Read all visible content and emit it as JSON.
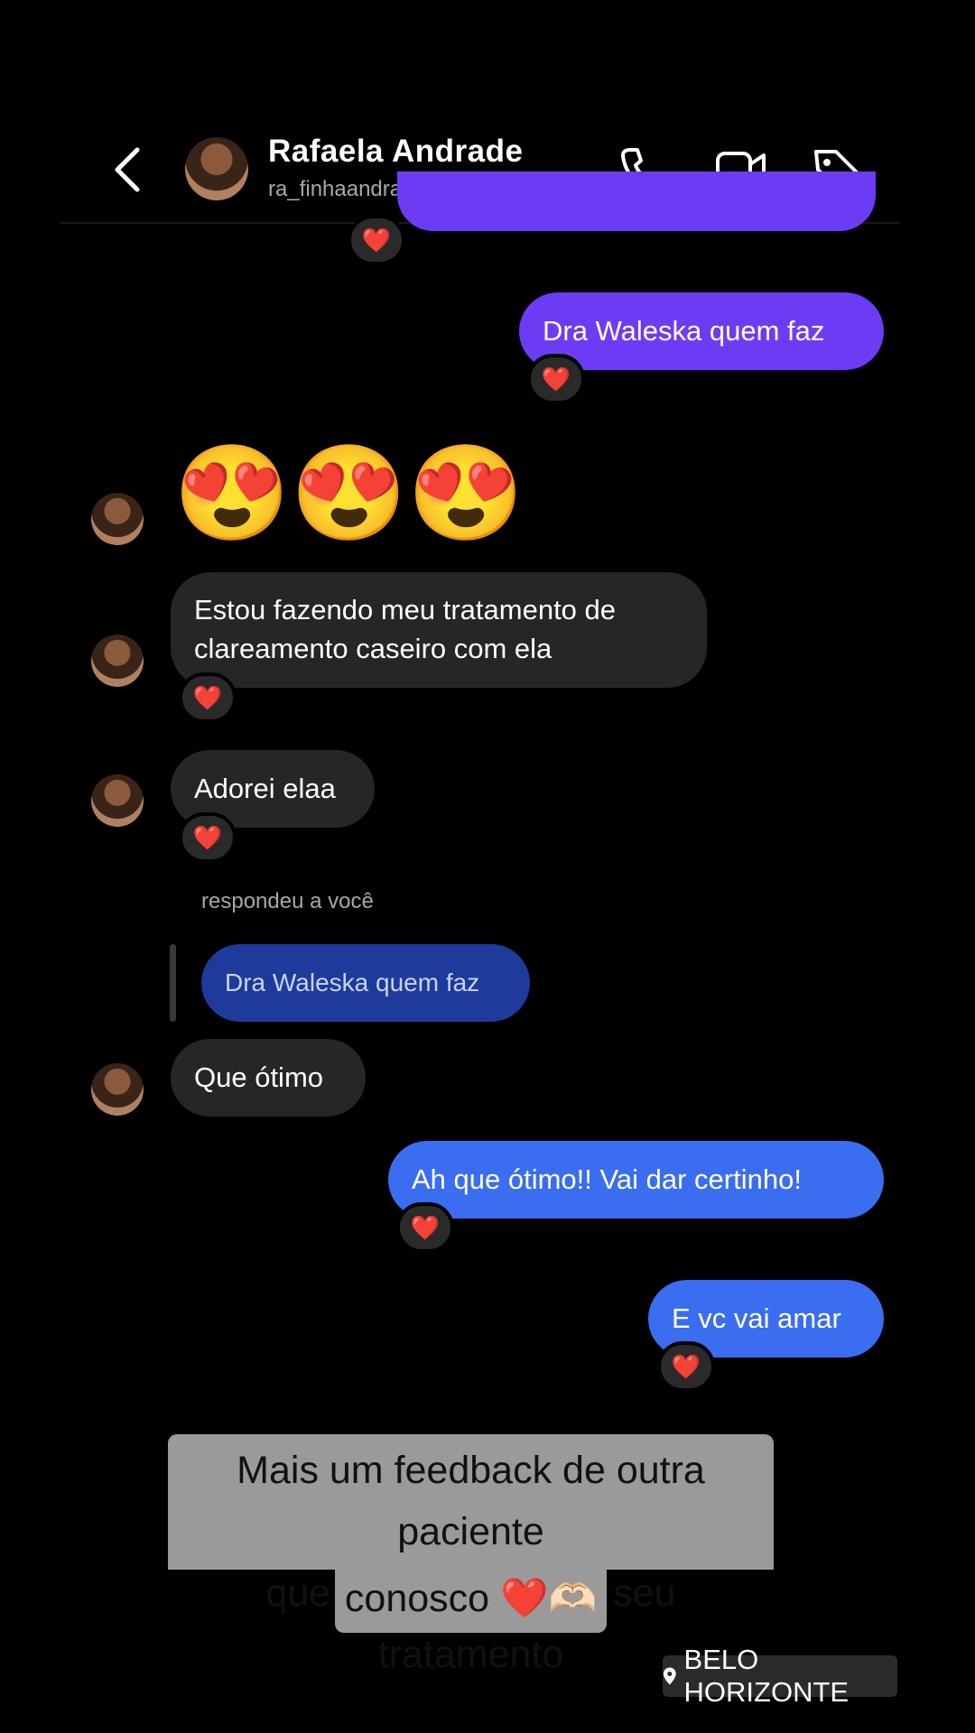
{
  "header": {
    "contact_name": "Rafaela  Andrade",
    "contact_handle": "ra_finhaandrade",
    "icons": [
      "chevron-left-icon",
      "phone-icon",
      "video-icon",
      "tag-icon"
    ]
  },
  "messages": [
    {
      "side": "out",
      "text": "Dra Waleska quem faz",
      "reaction": "❤️"
    },
    {
      "side": "in",
      "text": "😍😍😍"
    },
    {
      "side": "in",
      "text_line1": "Estou fazendo meu tratamento de",
      "text_line2": "clareamento caseiro com ela",
      "reaction": "❤️"
    },
    {
      "side": "in",
      "text": "Adorei elaa",
      "reaction": "❤️"
    },
    {
      "side": "in",
      "reply_label": "respondeu a você",
      "quoted": "Dra Waleska quem faz",
      "text": "Que ótimo"
    },
    {
      "side": "out",
      "text": "Ah que ótimo!! Vai dar certinho!",
      "reaction": "❤️"
    },
    {
      "side": "out",
      "text": "E vc vai amar",
      "reaction": "❤️"
    }
  ],
  "top_reaction": "❤️",
  "caption": {
    "line1": "Mais um feedback de outra paciente",
    "line2": "que agora terminou seu tratamento",
    "line3": "conosco ❤️🫶🏻"
  },
  "location": "BELO HORIZONTE",
  "colors": {
    "background": "#000000",
    "incoming": "#262626",
    "outgoing_purple": "#6c3cf5",
    "outgoing_blue": "#3a6df0",
    "quoted": "#1e3a9a",
    "caption_bg": "#9a9a9a"
  }
}
